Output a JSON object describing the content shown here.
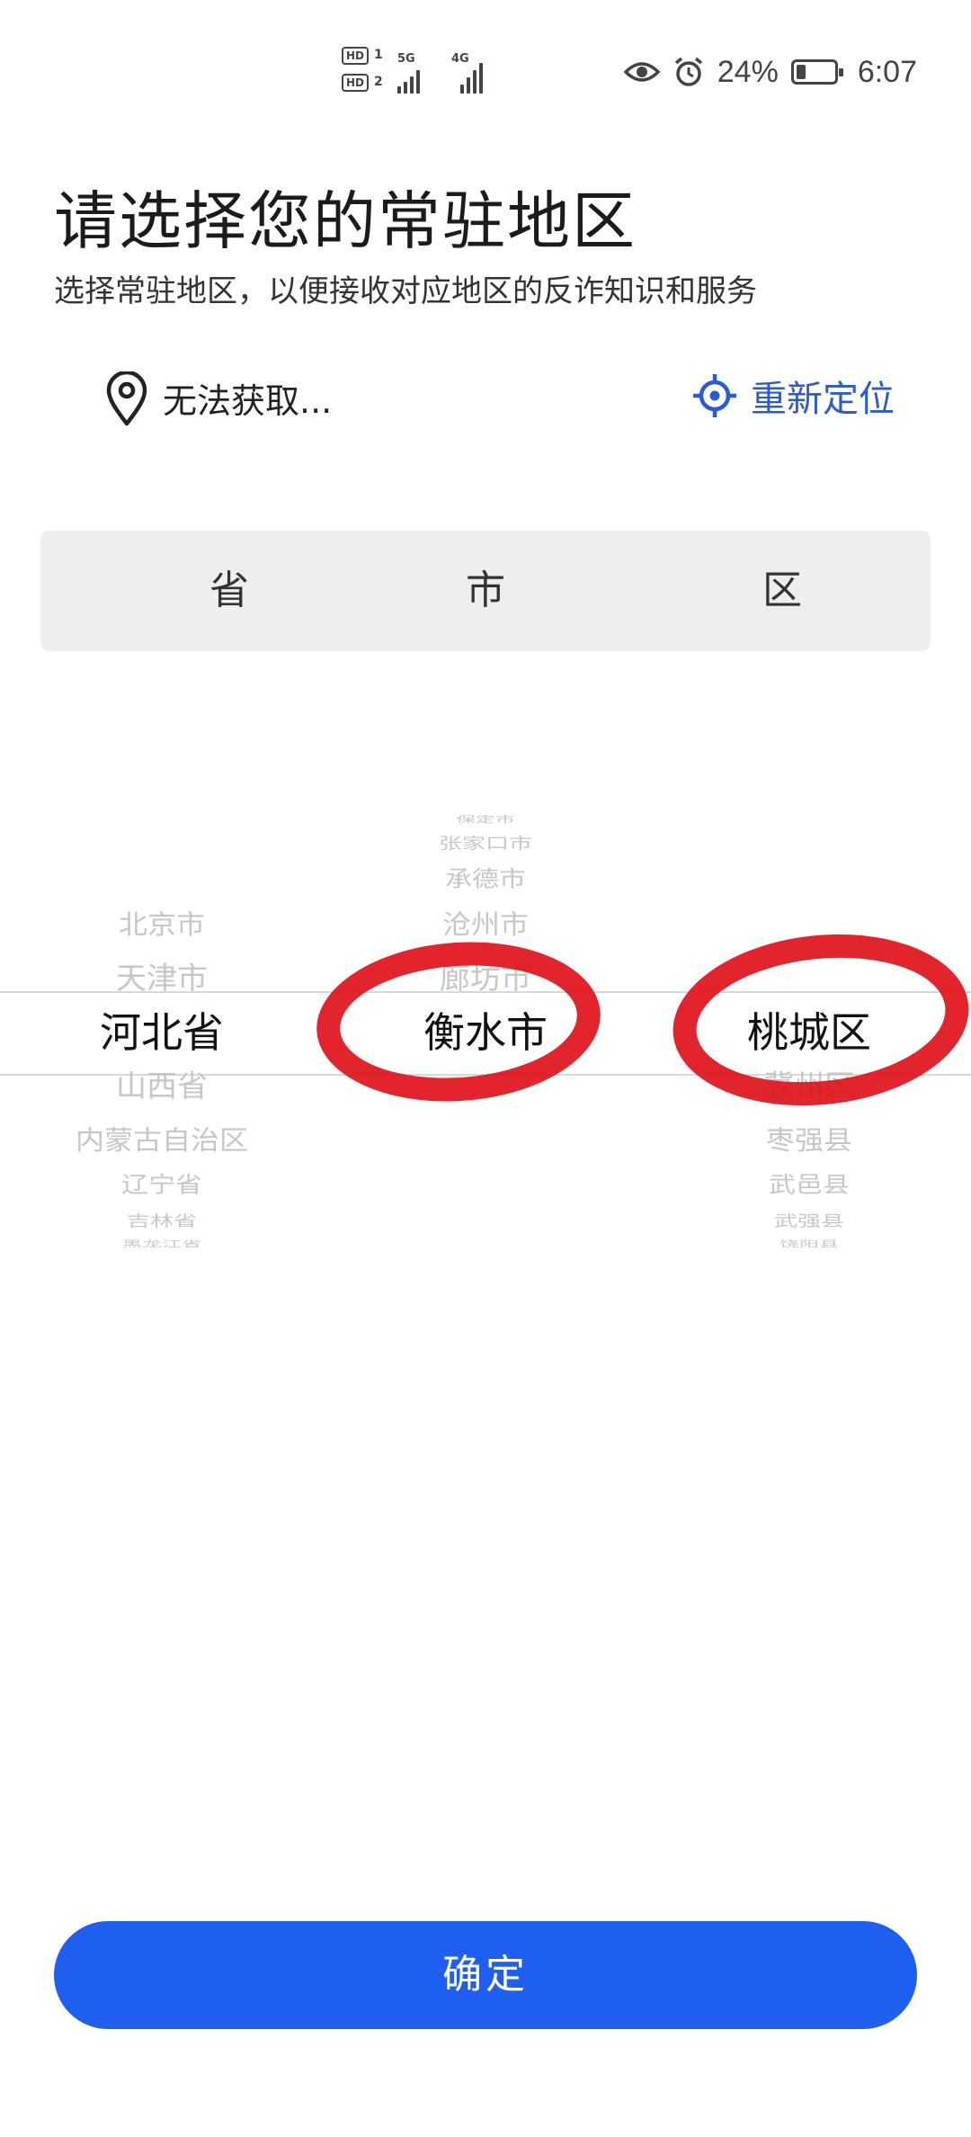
{
  "status_bar": {
    "sim1_badge": "HD",
    "sim1_index": "1",
    "sim2_badge": "HD",
    "sim2_index": "2",
    "network1": "5G",
    "network2": "4G",
    "battery_percent_text": "24%",
    "battery_level": 0.24,
    "time": "6:07",
    "icons": [
      "eye-icon",
      "alarm-icon",
      "battery-icon"
    ]
  },
  "header": {
    "title": "请选择您的常驻地区",
    "subtitle": "选择常驻地区，以便接收对应地区的反诈知识和服务"
  },
  "location": {
    "status_text": "无法获取...",
    "relocate_label": "重新定位",
    "accent_color": "#2a5ad6"
  },
  "picker": {
    "headers": [
      "省",
      "市",
      "区"
    ],
    "province": {
      "above": [
        "北京市",
        "天津市"
      ],
      "selected": "河北省",
      "below": [
        "山西省",
        "内蒙古自治区",
        "辽宁省",
        "吉林省",
        "黑龙江省"
      ]
    },
    "city": {
      "above": [
        "保定市",
        "张家口市",
        "承德市",
        "沧州市",
        "廊坊市"
      ],
      "selected": "衡水市",
      "below": []
    },
    "district": {
      "above": [],
      "selected": "桃城区",
      "below": [
        "冀州区",
        "枣强县",
        "武邑县",
        "武强县",
        "饶阳县"
      ]
    }
  },
  "annotation_color": "#e0121b",
  "confirm": {
    "label": "确定",
    "color": "#1f5ff0"
  }
}
